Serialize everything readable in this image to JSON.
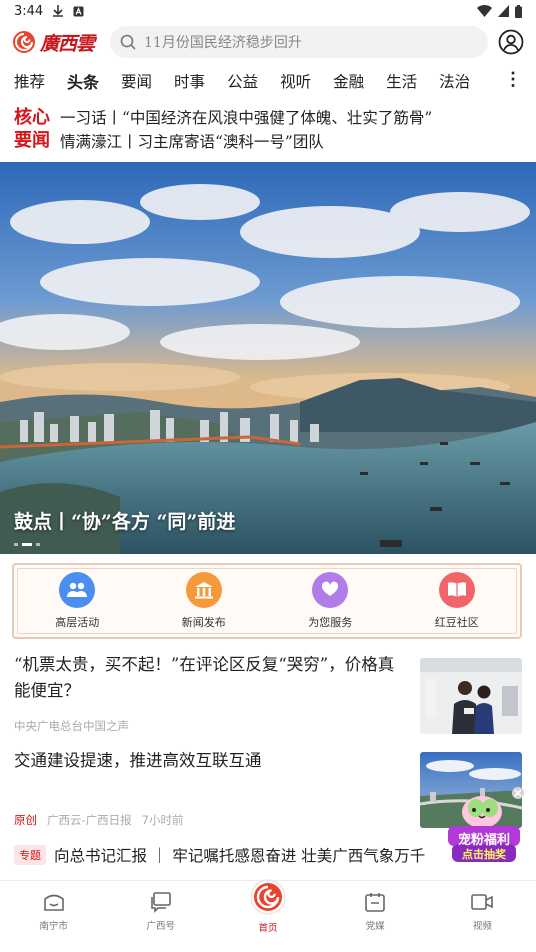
{
  "status_bar": {
    "time": "3:44"
  },
  "app": {
    "logo_text": "廣西雲"
  },
  "search": {
    "placeholder": "11月份国民经济稳步回升"
  },
  "channels": [
    "推荐",
    "头条",
    "要闻",
    "时事",
    "公益",
    "视听",
    "金融",
    "生活",
    "法治"
  ],
  "active_channel": "头条",
  "headline_block": {
    "label_line1": "核心",
    "label_line2": "要闻",
    "line1": "一习话丨“中国经济在风浪中强健了体魄、壮实了筋骨”",
    "line2": "情满濠江丨习主席寄语“澳科一号”团队"
  },
  "hero": {
    "caption": "鼓点丨“协”各方 “同”前进"
  },
  "services": [
    {
      "label": "高层活动",
      "icon": "people-icon",
      "color": "#4a8ef0"
    },
    {
      "label": "新闻发布",
      "icon": "building-icon",
      "color": "#f59a3a"
    },
    {
      "label": "为您服务",
      "icon": "heart-hands-icon",
      "color": "#b07ce8"
    },
    {
      "label": "红豆社区",
      "icon": "book-icon",
      "color": "#f0656a"
    }
  ],
  "news": [
    {
      "title": "“机票太贵，买不起！”在评论区反复“哭穷”，价格真能便宜？",
      "source": "中央广电总台中国之声"
    },
    {
      "title": "交通建设提速，推进高效互联互通",
      "tag": "原创",
      "source": "广西云-广西日报",
      "time": "7小时前"
    }
  ],
  "special": {
    "badge": "专题",
    "title": "向总书记汇报 ｜ 牢记嘱托感恩奋进 壮美广西气象万千"
  },
  "promo": {
    "line1": "宠粉福利",
    "line2": "点击抽奖"
  },
  "bottom_nav": [
    {
      "label": "南宁市",
      "icon": "city-icon"
    },
    {
      "label": "广西号",
      "icon": "chat-icon"
    },
    {
      "label": "首页",
      "icon": "home-logo-icon"
    },
    {
      "label": "党媒",
      "icon": "calendar-icon"
    },
    {
      "label": "视频",
      "icon": "video-icon"
    }
  ],
  "colors": {
    "brand_red": "#d7141b",
    "accent_orange": "#f59a3a"
  }
}
